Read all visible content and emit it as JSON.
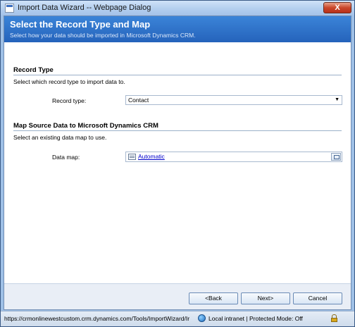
{
  "window": {
    "title": "Import Data Wizard -- Webpage Dialog",
    "close_label": "X"
  },
  "header": {
    "title": "Select the Record Type and Map",
    "subtitle": "Select how your data should be imported in Microsoft Dynamics CRM."
  },
  "record_type_section": {
    "title": "Record Type",
    "description": "Select which record type to import data to.",
    "field_label": "Record type:",
    "selected_value": "Contact"
  },
  "data_map_section": {
    "title": "Map Source Data to Microsoft Dynamics CRM",
    "description": "Select an existing data map to use.",
    "field_label": "Data map:",
    "value": "Automatic"
  },
  "buttons": {
    "back": "<Back",
    "next": "Next>",
    "cancel": "Cancel"
  },
  "statusbar": {
    "url": "https://crmonlinewestcustom.crm.dynamics.com/Tools/ImportWizard/Ir",
    "zone": "Local intranet | Protected Mode: Off"
  },
  "colors": {
    "header_bg": "#2563bb",
    "link": "#0000cc"
  }
}
